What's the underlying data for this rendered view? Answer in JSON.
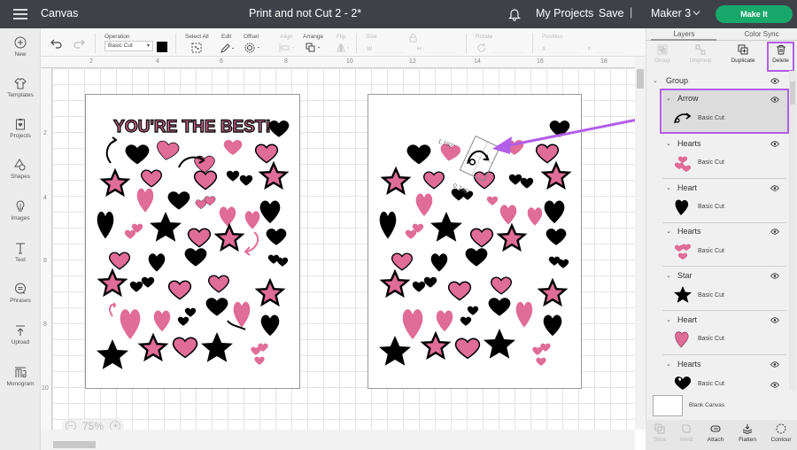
{
  "topbar": {
    "app_title": "Canvas",
    "project_title": "Print and not Cut 2 - 2*",
    "my_projects": "My Projects",
    "save": "Save",
    "separator": "|",
    "machine": "Maker 3",
    "make_it": "Make It",
    "make_it_color": "#19a86b"
  },
  "left_nav": [
    {
      "label": "New",
      "icon": "plus-circle-icon"
    },
    {
      "label": "Templates",
      "icon": "tshirt-icon"
    },
    {
      "label": "Projects",
      "icon": "clipboard-heart-icon"
    },
    {
      "label": "Shapes",
      "icon": "shapes-icon"
    },
    {
      "label": "Images",
      "icon": "lightbulb-icon"
    },
    {
      "label": "Text",
      "icon": "text-icon"
    },
    {
      "label": "Phrases",
      "icon": "speech-bubble-icon"
    },
    {
      "label": "Upload",
      "icon": "upload-icon"
    },
    {
      "label": "Monogram",
      "icon": "monogram-icon"
    }
  ],
  "toolbar": {
    "operation_label": "Operation",
    "operation_value": "Basic Cut",
    "operation_color": "#000000",
    "select_all": "Select All",
    "edit": "Edit",
    "offset": "Offset",
    "align": "Align",
    "arrange": "Arrange",
    "flip": "Flip",
    "size": "Size",
    "size_w": "W",
    "size_h": "H",
    "rotate": "Rotate",
    "position": "Position",
    "pos_x": "X",
    "pos_y": "Y"
  },
  "ruler": {
    "top": [
      "2",
      "4",
      "6",
      "8",
      "10",
      "12",
      "14",
      "16",
      "18"
    ],
    "left": [
      "2",
      "4",
      "6",
      "8",
      "10"
    ]
  },
  "canvas": {
    "zoom": "75%",
    "page_title_text": "YOU'RE THE BEST!",
    "dimension_width": "1.192\"",
    "dimension_height": "0.746\"",
    "pink": "#e06c98",
    "highlight_color": "#b15ee8"
  },
  "right_panel": {
    "tabs": [
      "Layers",
      "Color Sync"
    ],
    "actions": [
      {
        "label": "Group",
        "enabled": false
      },
      {
        "label": "Ungroup",
        "enabled": false
      },
      {
        "label": "Duplicate",
        "enabled": true
      },
      {
        "label": "Delete",
        "enabled": true
      }
    ],
    "group_label": "Group",
    "layers": [
      {
        "name": "Arrow",
        "op": "Basic Cut",
        "selected": true
      },
      {
        "name": "Hearts",
        "op": "Basic Cut"
      },
      {
        "name": "Heart",
        "op": "Basic Cut"
      },
      {
        "name": "Hearts",
        "op": "Basic Cut"
      },
      {
        "name": "Star",
        "op": "Basic Cut"
      },
      {
        "name": "Heart",
        "op": "Basic Cut"
      },
      {
        "name": "Hearts",
        "op": "Basic Cut"
      }
    ],
    "blank_canvas": "Blank Canvas",
    "bottom_actions": [
      {
        "label": "Slice",
        "enabled": false
      },
      {
        "label": "Weld",
        "enabled": false
      },
      {
        "label": "Attach",
        "enabled": true
      },
      {
        "label": "Flatten",
        "enabled": true
      },
      {
        "label": "Contour",
        "enabled": true
      }
    ]
  }
}
